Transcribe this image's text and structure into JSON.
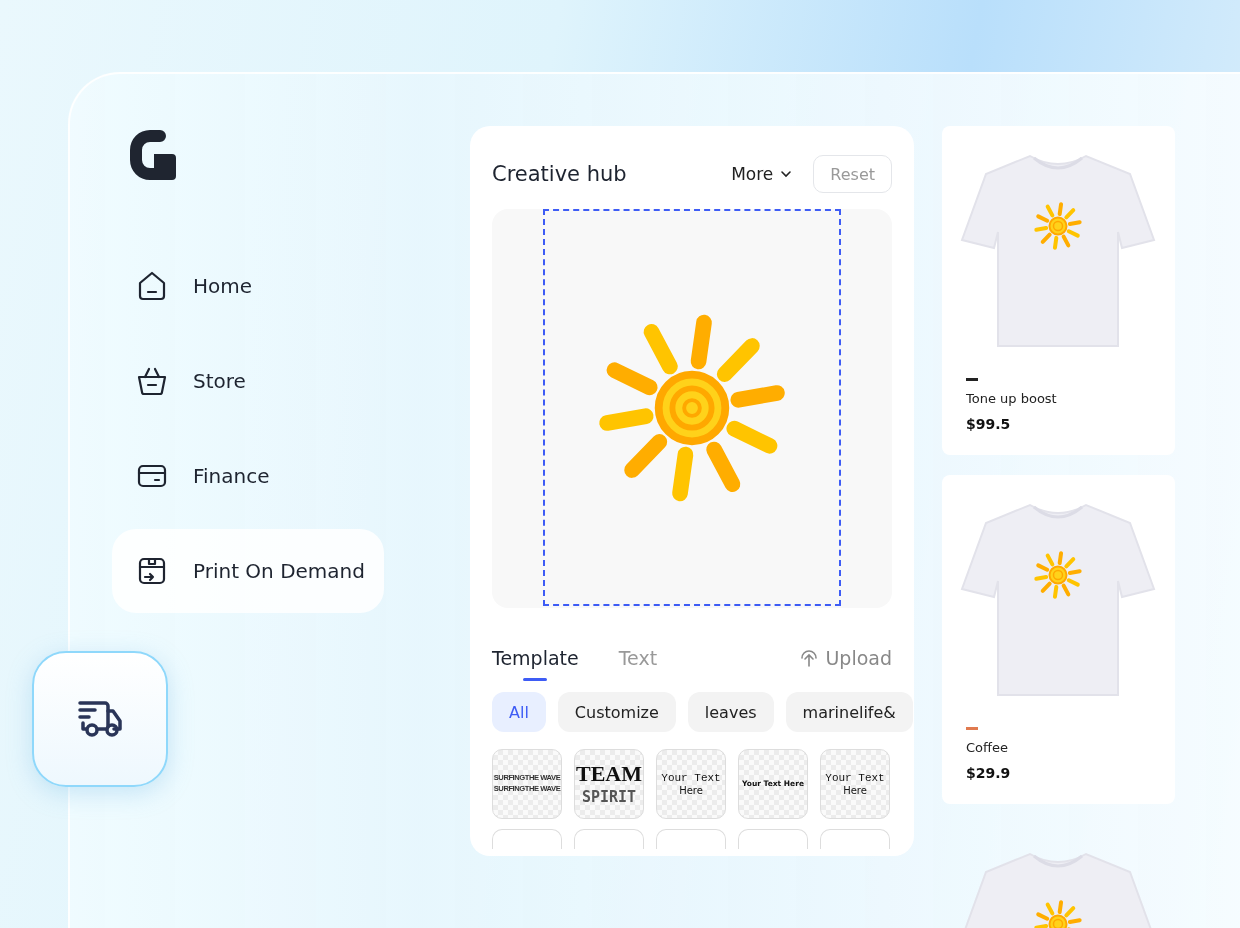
{
  "sidebar": {
    "items": [
      {
        "label": "Home",
        "selected": false
      },
      {
        "label": "Store",
        "selected": false
      },
      {
        "label": "Finance",
        "selected": false
      },
      {
        "label": "Print On Demand",
        "selected": true
      }
    ]
  },
  "creative_hub": {
    "title": "Creative hub",
    "more": "More",
    "reset": "Reset",
    "tabs": [
      {
        "label": "Template",
        "selected": true
      },
      {
        "label": "Text",
        "selected": false
      }
    ],
    "upload": "Upload",
    "chips": [
      {
        "label": "All",
        "selected": true
      },
      {
        "label": "Customize",
        "selected": false
      },
      {
        "label": "leaves",
        "selected": false
      },
      {
        "label": "marinelife&",
        "selected": false
      }
    ],
    "templates": [
      {
        "kind": "wave",
        "lines": [
          "SURFINGTHE WAVE",
          "SURFINGTHE WAVE"
        ]
      },
      {
        "kind": "team",
        "lines": [
          "TEAM",
          "SPIRIT"
        ]
      },
      {
        "kind": "mono",
        "lines": [
          "Your Text",
          "Here"
        ]
      },
      {
        "kind": "sans",
        "lines": [
          "Your Text Here"
        ]
      },
      {
        "kind": "mono",
        "lines": [
          "Your Text",
          "Here"
        ]
      }
    ]
  },
  "products": [
    {
      "name": "Tone up boost",
      "price": "$99.5",
      "color": "#222222"
    },
    {
      "name": "Coffee",
      "price": "$29.9",
      "color": "#e07a4f"
    }
  ]
}
